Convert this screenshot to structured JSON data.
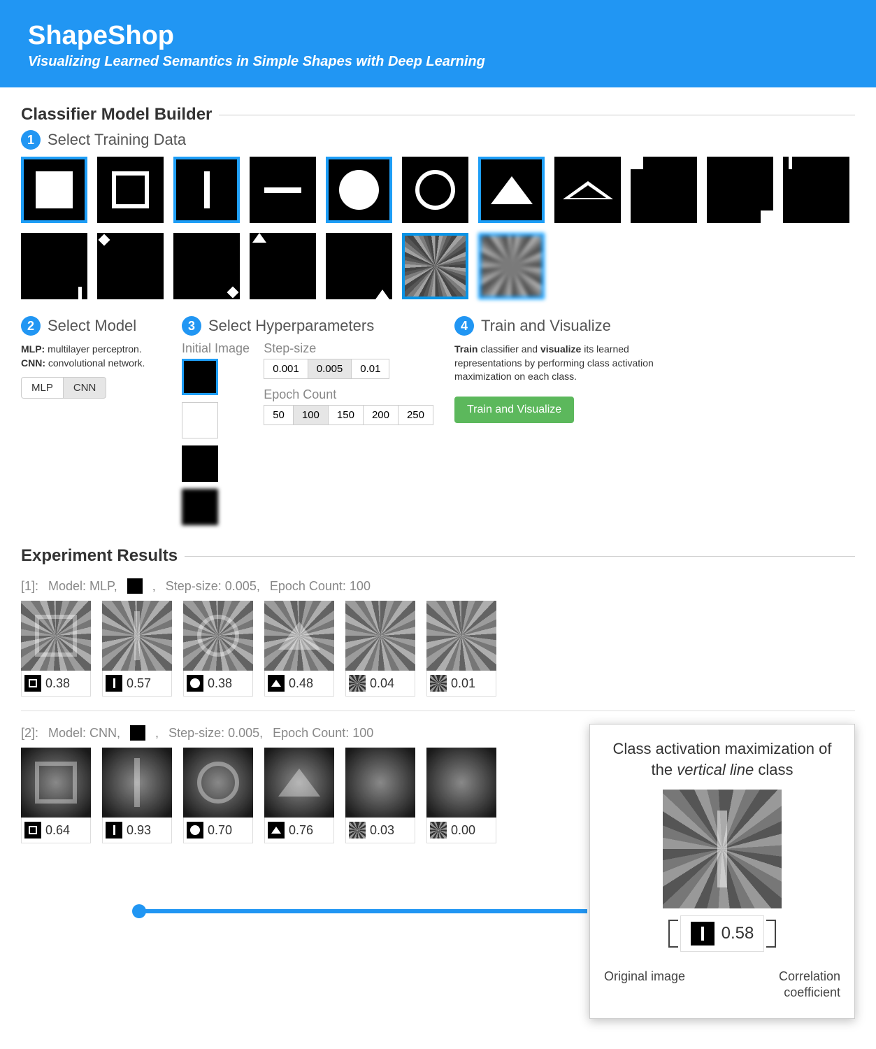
{
  "header": {
    "title": "ShapeShop",
    "subtitle": "Visualizing Learned Semantics in Simple Shapes with Deep Learning"
  },
  "builder": {
    "title": "Classifier Model Builder",
    "step1": {
      "num": "1",
      "label": "Select Training Data"
    },
    "shapes": [
      {
        "id": "square-filled",
        "selected": true
      },
      {
        "id": "square-outline",
        "selected": false
      },
      {
        "id": "vertical-line",
        "selected": true
      },
      {
        "id": "horizontal-line",
        "selected": false
      },
      {
        "id": "circle-filled",
        "selected": true
      },
      {
        "id": "circle-outline",
        "selected": false
      },
      {
        "id": "triangle-filled",
        "selected": true
      },
      {
        "id": "triangle-outline",
        "selected": false
      },
      {
        "id": "square-tl",
        "selected": false
      },
      {
        "id": "square-br",
        "selected": false
      },
      {
        "id": "line-tl",
        "selected": false
      },
      {
        "id": "line-br",
        "selected": false
      },
      {
        "id": "circle-tl",
        "selected": false
      },
      {
        "id": "circle-br",
        "selected": false
      },
      {
        "id": "triangle-tl",
        "selected": false
      },
      {
        "id": "triangle-br",
        "selected": false
      },
      {
        "id": "noise-fine",
        "selected": true
      },
      {
        "id": "noise-coarse",
        "selected": true
      }
    ],
    "step2": {
      "num": "2",
      "label": "Select Model",
      "desc_mlp_b": "MLP:",
      "desc_mlp": " multilayer perceptron.",
      "desc_cnn_b": "CNN:",
      "desc_cnn": " convolutional network.",
      "options": [
        "MLP",
        "CNN"
      ],
      "active": "CNN"
    },
    "step3": {
      "num": "3",
      "label": "Select Hyperparameters",
      "initial_label": "Initial Image",
      "initial_tiles": [
        "black",
        "white",
        "noise-fine",
        "noise-coarse"
      ],
      "initial_active": "black",
      "step_label": "Step-size",
      "steps": [
        "0.001",
        "0.005",
        "0.01"
      ],
      "step_active": "0.005",
      "epoch_label": "Epoch Count",
      "epochs": [
        "50",
        "100",
        "150",
        "200",
        "250"
      ],
      "epoch_active": "100"
    },
    "step4": {
      "num": "4",
      "label": "Train and Visualize",
      "desc_1": "Train",
      "desc_2": " classifier and ",
      "desc_3": "visualize",
      "desc_4": " its learned representations by performing class activation maximization on each class.",
      "button": "Train and Visualize"
    }
  },
  "results": {
    "title": "Experiment Results",
    "runs": [
      {
        "idx": "[1]:",
        "model_lbl": "Model: MLP,",
        "step_lbl": "Step-size: 0.005,",
        "epoch_lbl": "Epoch Count: 100",
        "kind": "mlp",
        "items": [
          {
            "icon": "square-outline",
            "coef": "0.38",
            "ghost": "square"
          },
          {
            "icon": "vertical-line",
            "coef": "0.57",
            "ghost": "vline"
          },
          {
            "icon": "circle-filled",
            "coef": "0.38",
            "ghost": "circle"
          },
          {
            "icon": "triangle-filled",
            "coef": "0.48",
            "ghost": "triangle"
          },
          {
            "icon": "noise-fine",
            "coef": "0.04",
            "ghost": "none"
          },
          {
            "icon": "noise-coarse",
            "coef": "0.01",
            "ghost": "none"
          }
        ]
      },
      {
        "idx": "[2]:",
        "model_lbl": "Model: CNN,",
        "step_lbl": "Step-size: 0.005,",
        "epoch_lbl": "Epoch Count: 100",
        "kind": "cnn",
        "items": [
          {
            "icon": "square-outline",
            "coef": "0.64",
            "ghost": "square"
          },
          {
            "icon": "vertical-line",
            "coef": "0.93",
            "ghost": "vline"
          },
          {
            "icon": "circle-filled",
            "coef": "0.70",
            "ghost": "circle"
          },
          {
            "icon": "triangle-filled",
            "coef": "0.76",
            "ghost": "triangle"
          },
          {
            "icon": "noise-fine",
            "coef": "0.03",
            "ghost": "none"
          },
          {
            "icon": "noise-coarse",
            "coef": "0.00",
            "ghost": "none"
          }
        ]
      }
    ]
  },
  "callout": {
    "title_1": "Class activation maximization of the ",
    "title_em": "vertical line",
    "title_2": " class",
    "coef": "0.58",
    "left_label": "Original image",
    "right_label": "Correlation coefficient"
  }
}
